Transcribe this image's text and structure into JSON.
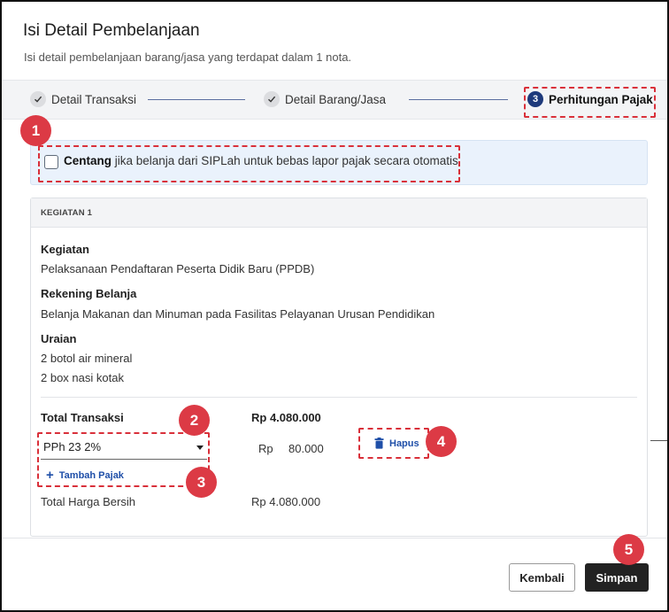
{
  "dialog": {
    "title": "Isi Detail Pembelanjaan",
    "subtitle": "Isi detail pembelanjaan barang/jasa yang terdapat dalam 1 nota."
  },
  "stepper": {
    "steps": [
      {
        "label": "Detail Transaksi",
        "state": "done"
      },
      {
        "label": "Detail Barang/Jasa",
        "state": "done"
      },
      {
        "label": "Perhitungan Pajak",
        "state": "active",
        "number": "3"
      }
    ]
  },
  "siplah": {
    "checked": false,
    "bold_text": "Centang",
    "text": " jika belanja dari SIPLah untuk bebas lapor pajak secara otomatis"
  },
  "kegiatan": {
    "header": "KEGIATAN 1",
    "kegiatan_label": "Kegiatan",
    "kegiatan_value": "Pelaksanaan Pendaftaran Peserta Didik Baru (PPDB)",
    "rekening_label": "Rekening Belanja",
    "rekening_value": "Belanja Makanan dan Minuman pada Fasilitas Pelayanan Urusan Pendidikan",
    "uraian_label": "Uraian",
    "uraian_items": [
      "2 botol air mineral",
      "2 box nasi kotak"
    ]
  },
  "pajak": {
    "total_transaksi_label": "Total Transaksi",
    "total_transaksi_value": "Rp 4.080.000",
    "selected_tax": "PPh 23 2%",
    "tax_currency": "Rp",
    "tax_amount": "80.000",
    "hapus_label": "Hapus",
    "tambah_label": "Tambah Pajak",
    "total_bersih_label": "Total Harga Bersih",
    "total_bersih_value": "Rp 4.080.000"
  },
  "footer": {
    "kembali_label": "Kembali",
    "simpan_label": "Simpan"
  },
  "annotations": {
    "marker_1": "1",
    "marker_2": "2",
    "marker_3": "3",
    "marker_4": "4",
    "marker_5": "5",
    "highlight_color": "#d9303a"
  },
  "colors": {
    "accent": "#1f4fa8",
    "step_active": "#1e3a7b",
    "primary_button": "#222222",
    "info_bg": "#eaf2fc"
  }
}
